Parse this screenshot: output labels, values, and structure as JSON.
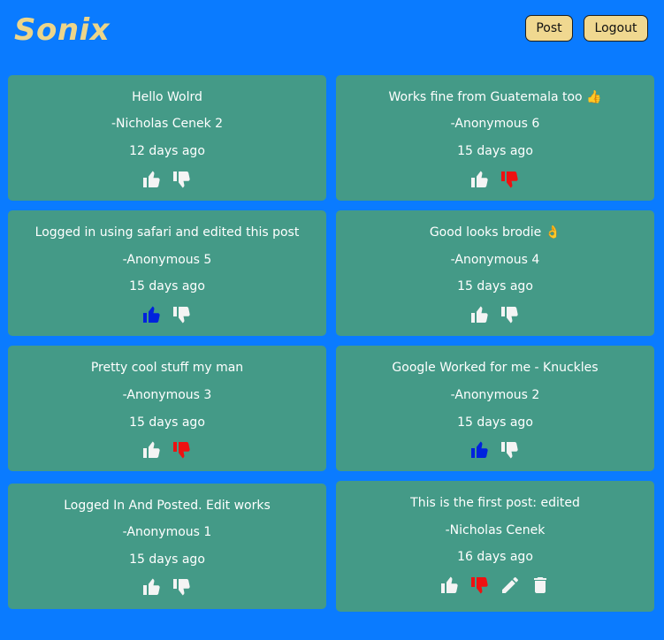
{
  "header": {
    "logo": "Sonix",
    "post_label": "Post",
    "logout_label": "Logout"
  },
  "colors": {
    "like_active": "#0022dd",
    "dislike_active": "#ee1111",
    "inactive": "#f4f4f4"
  },
  "posts": [
    {
      "text": "Hello Wolrd",
      "author": "-Nicholas Cenek 2",
      "time": "12 days ago",
      "liked": false,
      "disliked": false,
      "owner": false
    },
    {
      "text": "Works fine from Guatemala too 👍",
      "author": "-Anonymous 6",
      "time": "15 days ago",
      "liked": false,
      "disliked": true,
      "owner": false
    },
    {
      "text": "Logged in using safari and edited this post",
      "author": "-Anonymous 5",
      "time": "15 days ago",
      "liked": true,
      "disliked": false,
      "owner": false
    },
    {
      "text": "Good looks brodie 👌",
      "author": "-Anonymous 4",
      "time": "15 days ago",
      "liked": false,
      "disliked": false,
      "owner": false
    },
    {
      "text": "Pretty cool stuff my man",
      "author": "-Anonymous 3",
      "time": "15 days ago",
      "liked": false,
      "disliked": true,
      "owner": false
    },
    {
      "text": "Google Worked for me - Knuckles",
      "author": "-Anonymous 2",
      "time": "15 days ago",
      "liked": true,
      "disliked": false,
      "owner": false
    },
    {
      "text": "Logged In And Posted. Edit works",
      "author": "-Anonymous 1",
      "time": "15 days ago",
      "liked": false,
      "disliked": false,
      "owner": false
    },
    {
      "text": "This is the first post: edited",
      "author": "-Nicholas Cenek",
      "time": "16 days ago",
      "liked": false,
      "disliked": true,
      "owner": true
    }
  ]
}
